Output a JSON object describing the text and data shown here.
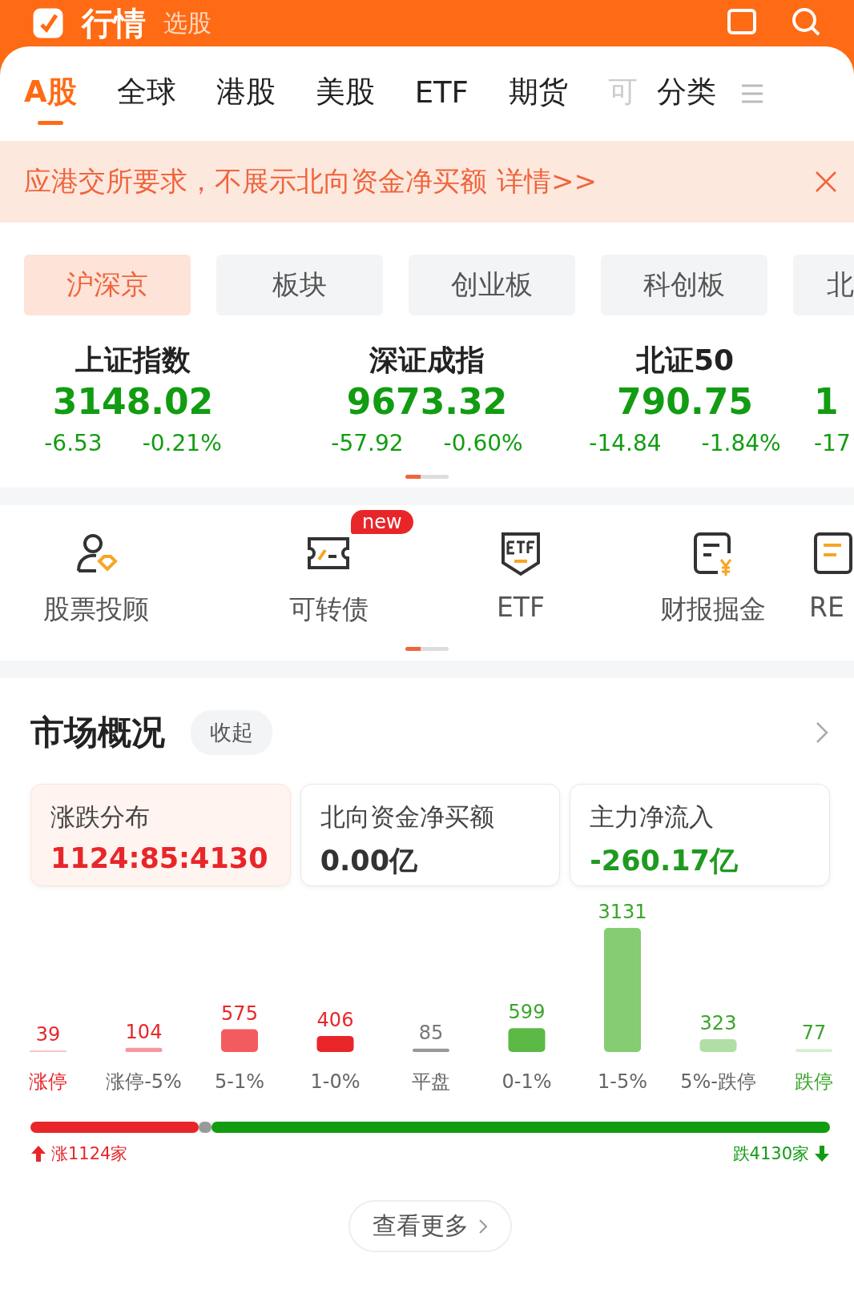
{
  "header": {
    "tabs": [
      {
        "label": "行情",
        "selected": true
      },
      {
        "label": "选股",
        "selected": false
      }
    ]
  },
  "market_tabs": [
    {
      "label": "A股",
      "selected": true,
      "faded": false
    },
    {
      "label": "全球",
      "selected": false,
      "faded": false
    },
    {
      "label": "港股",
      "selected": false,
      "faded": false
    },
    {
      "label": "美股",
      "selected": false,
      "faded": false
    },
    {
      "label": "ETF",
      "selected": false,
      "faded": false
    },
    {
      "label": "期货",
      "selected": false,
      "faded": false
    },
    {
      "label": "可",
      "selected": false,
      "faded": true
    }
  ],
  "category_button": "分类",
  "notice": {
    "text": "应港交所要求，不展示北向资金净买额",
    "link": "详情>>"
  },
  "sub_tabs": [
    {
      "label": "沪深京",
      "selected": true
    },
    {
      "label": "板块",
      "selected": false
    },
    {
      "label": "创业板",
      "selected": false
    },
    {
      "label": "科创板",
      "selected": false
    },
    {
      "label": "北",
      "selected": false
    }
  ],
  "indices": [
    {
      "name": "上证指数",
      "value": "3148.02",
      "change": "-6.53",
      "percent": "-0.21%"
    },
    {
      "name": "深证成指",
      "value": "9673.32",
      "change": "-57.92",
      "percent": "-0.60%"
    },
    {
      "name": "北证50",
      "value": "790.75",
      "change": "-14.84",
      "percent": "-1.84%"
    },
    {
      "value": "1",
      "change": "-17"
    }
  ],
  "shortcuts": [
    {
      "label": "股票投顾",
      "kind": "advisor"
    },
    {
      "label": "可转债",
      "kind": "bond",
      "badge": "new"
    },
    {
      "label": "ETF",
      "kind": "etf"
    },
    {
      "label": "财报掘金",
      "kind": "report"
    },
    {
      "label": "RE",
      "kind": "doc"
    }
  ],
  "market_overview": {
    "title": "市场概况",
    "collapse_button": "收起",
    "cards": [
      {
        "title": "涨跌分布",
        "value": "1124:85:4130",
        "selected": true,
        "color": "#e8262a"
      },
      {
        "title": "北向资金净买额",
        "value": "0.00亿",
        "selected": false,
        "color": "#333333"
      },
      {
        "title": "主力净流入",
        "value": "-260.17亿",
        "selected": false,
        "color": "#1f9a1f"
      }
    ],
    "chart_data": {
      "type": "bar",
      "categories": [
        "涨停",
        "涨停-5%",
        "5-1%",
        "1-0%",
        "平盘",
        "0-1%",
        "1-5%",
        "5%-跌停",
        "跌停"
      ],
      "data_labels": true,
      "values": [
        39,
        104,
        575,
        406,
        85,
        599,
        3131,
        323,
        77
      ]
    },
    "ratio_bar": [
      {
        "level": 0.2105,
        "color": "#e8262a"
      },
      {
        "level": 0.0159,
        "color": "#999999"
      },
      {
        "level": 0.7736,
        "color": "#129c12"
      }
    ],
    "up_label": "涨1124家",
    "down_label": "跌4130家",
    "more_button": "查看更多"
  }
}
